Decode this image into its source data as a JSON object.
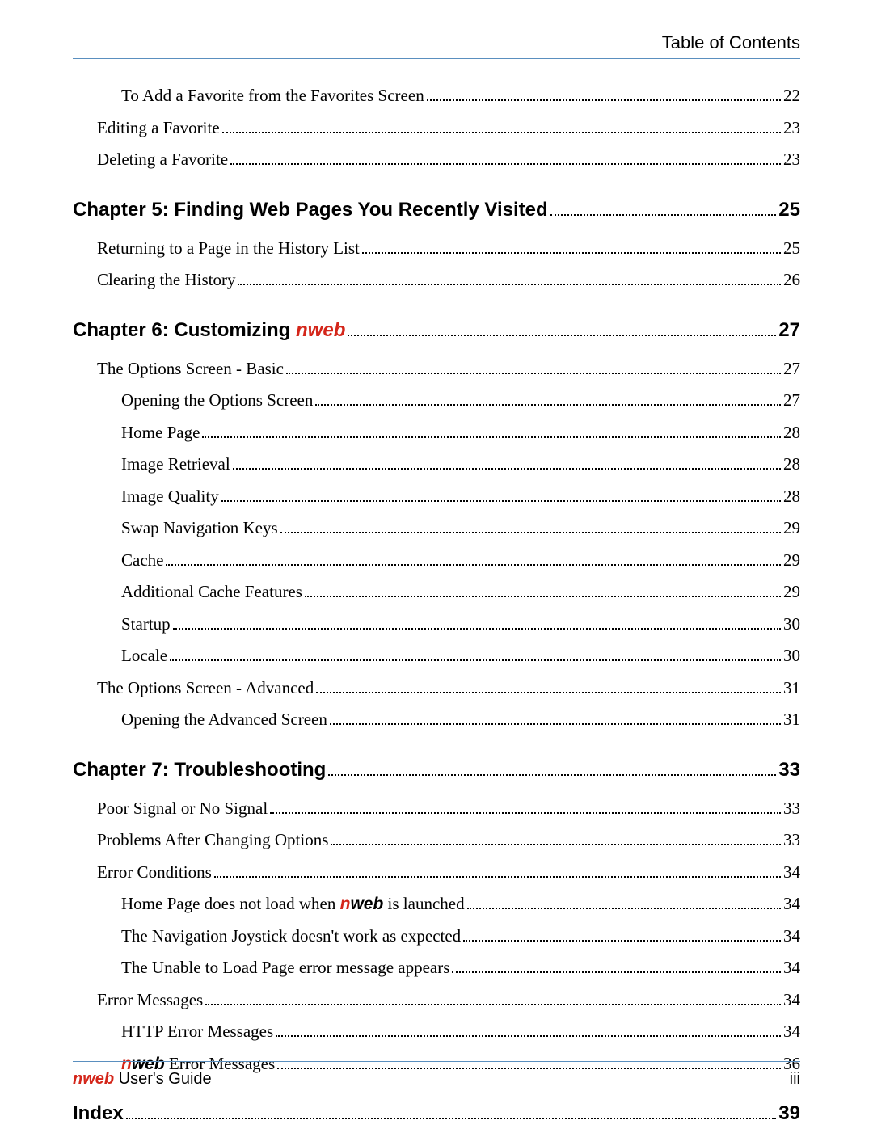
{
  "header": {
    "title": "Table of Contents"
  },
  "toc": [
    {
      "level": 3,
      "title": "To Add a Favorite from the Favorites Screen",
      "page": "22"
    },
    {
      "level": 2,
      "title": "Editing a Favorite",
      "page": "23"
    },
    {
      "level": 2,
      "title": "Deleting a Favorite",
      "page": "23"
    },
    {
      "level": 1,
      "title": "Chapter 5: Finding Web Pages You Recently Visited",
      "page": "25"
    },
    {
      "level": 2,
      "title": "Returning to a Page in the History List",
      "page": "25"
    },
    {
      "level": 2,
      "title": "Clearing the History",
      "page": "26"
    },
    {
      "level": 1,
      "title_pre": "Chapter 6: Customizing ",
      "nweb": "nweb",
      "page": "27"
    },
    {
      "level": 2,
      "title": "The Options Screen - Basic",
      "page": "27"
    },
    {
      "level": 3,
      "title": "Opening the Options Screen",
      "page": "27"
    },
    {
      "level": 3,
      "title": "Home Page",
      "page": "28"
    },
    {
      "level": 3,
      "title": "Image Retrieval",
      "page": "28"
    },
    {
      "level": 3,
      "title": "Image Quality",
      "page": "28"
    },
    {
      "level": 3,
      "title": "Swap Navigation Keys",
      "page": "29"
    },
    {
      "level": 3,
      "title": "Cache",
      "page": "29"
    },
    {
      "level": 3,
      "title": "Additional Cache Features",
      "page": "29"
    },
    {
      "level": 3,
      "title": "Startup",
      "page": "30"
    },
    {
      "level": 3,
      "title": "Locale",
      "page": "30"
    },
    {
      "level": 2,
      "title": "The Options Screen - Advanced",
      "page": "31"
    },
    {
      "level": 3,
      "title": "Opening the Advanced Screen",
      "page": "31"
    },
    {
      "level": 1,
      "title": "Chapter 7: Troubleshooting",
      "page": "33"
    },
    {
      "level": 2,
      "title": "Poor Signal or No Signal",
      "page": "33"
    },
    {
      "level": 2,
      "title": "Problems After Changing Options",
      "page": "33"
    },
    {
      "level": 2,
      "title": "Error Conditions",
      "page": "34"
    },
    {
      "level": 3,
      "title_pre": "Home Page does not load when ",
      "nweb_bold": "nweb",
      "title_post": " is launched",
      "page": "34"
    },
    {
      "level": 3,
      "title": "The Navigation Joystick doesn't work as expected",
      "page": "34"
    },
    {
      "level": 3,
      "title": "The Unable to Load Page error message appears",
      "page": "34"
    },
    {
      "level": 2,
      "title": "Error Messages",
      "page": "34"
    },
    {
      "level": 3,
      "title": "HTTP Error Messages",
      "page": "34"
    },
    {
      "level": 3,
      "nweb_bold": "nweb",
      "title_post": " Error Messages",
      "page": "36"
    },
    {
      "level": 1,
      "title": "Index",
      "page": "39"
    }
  ],
  "footer": {
    "nweb": "nweb",
    "guide": " User's Guide",
    "pagenum": "iii"
  }
}
